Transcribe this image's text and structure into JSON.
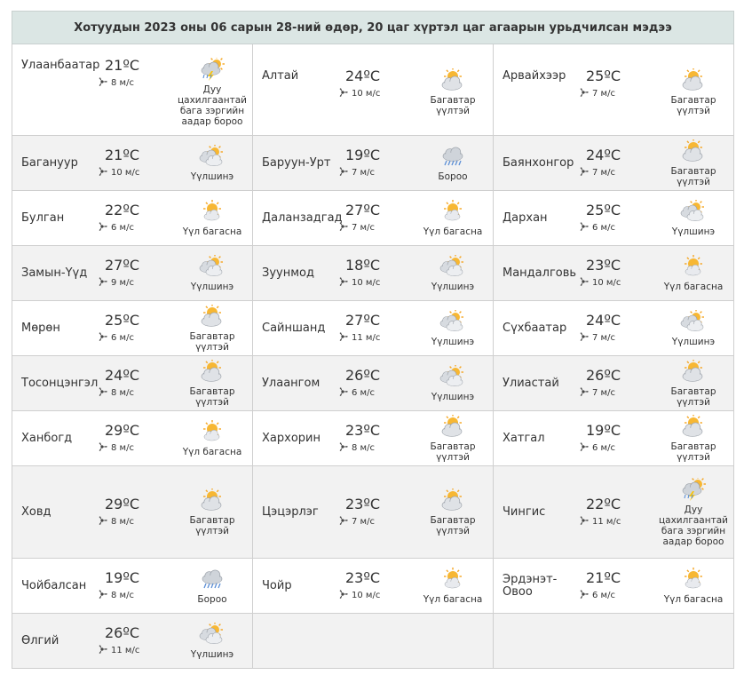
{
  "title": "Хотуудын 2023 оны 06 сарын 28-ний өдөр, 20 цаг хүртэл цаг агаарын урьдчилсан мэдээ",
  "rows": [
    [
      {
        "city": "Улаанбаатар",
        "temp": "21ºC",
        "wind": "8 м/с",
        "icon": "thunderstorm-icon",
        "cond": "Дуу цахилгаантай бага зэргийн аадар бороо"
      },
      {
        "city": "Алтай",
        "temp": "24ºC",
        "wind": "10 м/с",
        "icon": "mostly-cloudy-icon",
        "cond": "Багавтар үүлтэй"
      },
      {
        "city": "Арвайхээр",
        "temp": "25ºC",
        "wind": "7 м/с",
        "icon": "mostly-cloudy-icon",
        "cond": "Багавтар үүлтэй"
      }
    ],
    [
      {
        "city": "Багануур",
        "temp": "21ºC",
        "wind": "10 м/с",
        "icon": "cloudy-icon",
        "cond": "Үүлшинэ"
      },
      {
        "city": "Баруун-Урт",
        "temp": "19ºC",
        "wind": "7 м/с",
        "icon": "rain-icon",
        "cond": "Бороо"
      },
      {
        "city": "Баянхонгор",
        "temp": "24ºC",
        "wind": "7 м/с",
        "icon": "mostly-cloudy-icon",
        "cond": "Багавтар үүлтэй"
      }
    ],
    [
      {
        "city": "Булган",
        "temp": "22ºC",
        "wind": "6 м/с",
        "icon": "partly-cloudy-icon",
        "cond": "Үүл багасна"
      },
      {
        "city": "Даланзадгад",
        "temp": "27ºC",
        "wind": "7 м/с",
        "icon": "partly-cloudy-icon",
        "cond": "Үүл багасна"
      },
      {
        "city": "Дархан",
        "temp": "25ºC",
        "wind": "6 м/с",
        "icon": "cloudy-icon",
        "cond": "Үүлшинэ"
      }
    ],
    [
      {
        "city": "Замын-Үүд",
        "temp": "27ºC",
        "wind": "9 м/с",
        "icon": "cloudy-icon",
        "cond": "Үүлшинэ"
      },
      {
        "city": "Зуунмод",
        "temp": "18ºC",
        "wind": "10 м/с",
        "icon": "cloudy-icon",
        "cond": "Үүлшинэ"
      },
      {
        "city": "Мандалговь",
        "temp": "23ºC",
        "wind": "10 м/с",
        "icon": "partly-cloudy-icon",
        "cond": "Үүл багасна"
      }
    ],
    [
      {
        "city": "Мөрөн",
        "temp": "25ºC",
        "wind": "6 м/с",
        "icon": "mostly-cloudy-icon",
        "cond": "Багавтар үүлтэй"
      },
      {
        "city": "Сайншанд",
        "temp": "27ºC",
        "wind": "11 м/с",
        "icon": "cloudy-icon",
        "cond": "Үүлшинэ"
      },
      {
        "city": "Сүхбаатар",
        "temp": "24ºC",
        "wind": "7 м/с",
        "icon": "cloudy-icon",
        "cond": "Үүлшинэ"
      }
    ],
    [
      {
        "city": "Тосонцэнгэл",
        "temp": "24ºC",
        "wind": "8 м/с",
        "icon": "mostly-cloudy-icon",
        "cond": "Багавтар үүлтэй"
      },
      {
        "city": "Улаангом",
        "temp": "26ºC",
        "wind": "6 м/с",
        "icon": "cloudy-icon",
        "cond": "Үүлшинэ"
      },
      {
        "city": "Улиастай",
        "temp": "26ºC",
        "wind": "7 м/с",
        "icon": "mostly-cloudy-icon",
        "cond": "Багавтар үүлтэй"
      }
    ],
    [
      {
        "city": "Ханбогд",
        "temp": "29ºC",
        "wind": "8 м/с",
        "icon": "partly-cloudy-icon",
        "cond": "Үүл багасна"
      },
      {
        "city": "Хархорин",
        "temp": "23ºC",
        "wind": "8 м/с",
        "icon": "mostly-cloudy-icon",
        "cond": "Багавтар үүлтэй"
      },
      {
        "city": "Хатгал",
        "temp": "19ºC",
        "wind": "6 м/с",
        "icon": "mostly-cloudy-icon",
        "cond": "Багавтар үүлтэй"
      }
    ],
    [
      {
        "city": "Ховд",
        "temp": "29ºC",
        "wind": "8 м/с",
        "icon": "mostly-cloudy-icon",
        "cond": "Багавтар үүлтэй"
      },
      {
        "city": "Цэцэрлэг",
        "temp": "23ºC",
        "wind": "7 м/с",
        "icon": "mostly-cloudy-icon",
        "cond": "Багавтар үүлтэй"
      },
      {
        "city": "Чингис",
        "temp": "22ºC",
        "wind": "11 м/с",
        "icon": "thunderstorm-icon",
        "cond": "Дуу цахилгаантай бага зэргийн аадар бороо"
      }
    ],
    [
      {
        "city": "Чойбалсан",
        "temp": "19ºC",
        "wind": "8 м/с",
        "icon": "rain-icon",
        "cond": "Бороо"
      },
      {
        "city": "Чойр",
        "temp": "23ºC",
        "wind": "10 м/с",
        "icon": "partly-cloudy-icon",
        "cond": "Үүл багасна"
      },
      {
        "city": "Эрдэнэт-Овоо",
        "temp": "21ºC",
        "wind": "6 м/с",
        "icon": "partly-cloudy-icon",
        "cond": "Үүл багасна"
      }
    ],
    [
      {
        "city": "Өлгий",
        "temp": "26ºC",
        "wind": "11 м/с",
        "icon": "cloudy-icon",
        "cond": "Үүлшинэ"
      },
      null,
      null
    ]
  ],
  "colors": {
    "header_bg": "#dbe6e4",
    "row_alt_bg": "#f2f2f2",
    "border": "#cfcfcf",
    "sun": "#f5a623",
    "cloud": "#c8ccd2"
  }
}
